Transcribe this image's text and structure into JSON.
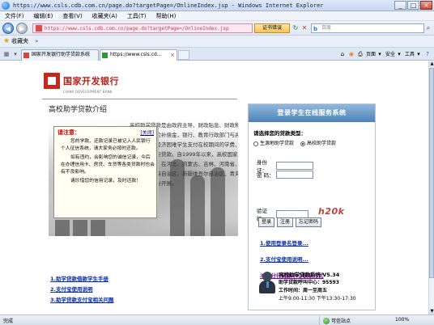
{
  "window": {
    "title": "https://www.csls.cdb.com.cn/page.do?targetPage=/OnlineIndex.jsp - Windows Internet Explorer",
    "min": "_",
    "max": "□",
    "close": "×"
  },
  "menu": [
    "文件(F)",
    "编辑(E)",
    "查看(V)",
    "收藏夹(A)",
    "工具(T)",
    "帮助(H)"
  ],
  "address": {
    "url": "https://www.csls.cdb.com.cn/page.do?targetPage=/OnlineIndex.jsp",
    "cert": "证书错误",
    "search_placeholder": "百度"
  },
  "favorites": {
    "label": "收藏夹",
    "more": "»"
  },
  "tabs": [
    {
      "label": "国家开发银行助学贷款系统"
    },
    {
      "label": "https://www.csls.cd..."
    }
  ],
  "command_bar": {
    "page": "页面",
    "safety": "安全",
    "tools": "工具"
  },
  "logo": {
    "cn": "国家开发银行",
    "en": "CHINA DEVELOPMENT BANK"
  },
  "page_title": "高校助学贷款介绍",
  "body_text": [
    "高校助学贷款是由政府主导、财政贴息、财政和高校共同给予",
    "银行一定风险补偿金，银行、教育行政部门与高校共同操作的，帮",
    "助高校家庭经济困难学生支付在校期间的学费、住宿费和基本",
    "生活费的银行贷款。自1999年以来，高校国家助学贷款政策体",
    "系逐步建立，在河北、内蒙古、吉林、河南省、广东省、贵州",
    "省、宁夏回族自治区、新疆维吾尔自治区、青海省、西藏",
    "自治区等省份开展。"
  ],
  "notice": {
    "title": "请注意：",
    "close": "[关闭]",
    "paragraphs": [
      "您的学款、还款记录已被记入人民银行个人征信系统，请大家务必按时还款。",
      "如有违约，会影响您的诚信记录，今后在办理信用卡、房贷、车贷等各类贷款时也会有不良影响。",
      "请珍惜您的信用记录，及时还款！"
    ]
  },
  "links": [
    "1.助学贷款借款学生手册",
    "2.支付宝使用说明",
    "3.助学贷款支付宝相关问题"
  ],
  "login": {
    "header": "登录学生在线服务系统",
    "select_title": "请选择您的贷款类型：",
    "options": [
      "生源地助学贷款",
      "高校助学贷款"
    ],
    "selected_index": 1,
    "id_label": "身份证：",
    "password_label": "密  码：",
    "captcha_label": "验证码：",
    "captcha_text": "h20k",
    "buttons": [
      "登录",
      "注册",
      "忘记密码"
    ],
    "links": [
      "1.使用登录名登录...",
      "2.支付宝使用说明...",
      "3.各分行贷款中心联系方式"
    ]
  },
  "support": {
    "line1": "高校助学贷款系统  V5.34",
    "line2": "助学贷款呼叫中心：95593",
    "line3": "工作时间：周一至周五",
    "line4": "上午9:00-11:30  下午13:30-17:30"
  },
  "status": {
    "done": "完成",
    "zone": "可信站点",
    "zoom": "100%"
  }
}
